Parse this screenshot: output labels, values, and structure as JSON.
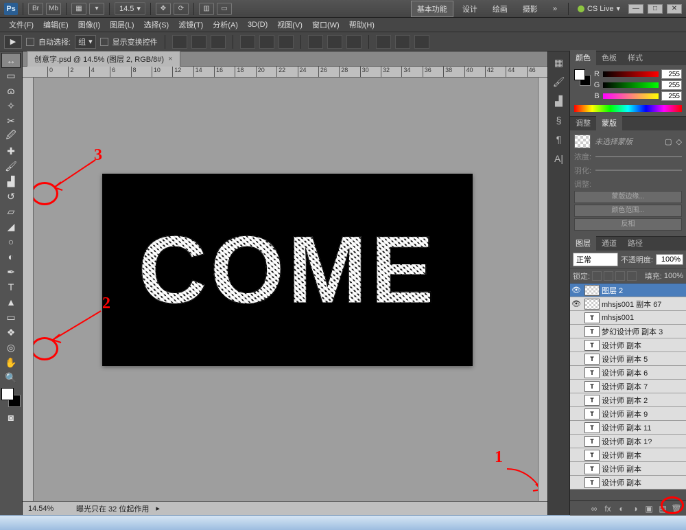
{
  "app": {
    "logo": "Ps"
  },
  "titlebar": {
    "zoom": "14.5",
    "workspaces": {
      "basic": "基本功能",
      "design": "设计",
      "draw": "绘画",
      "photo": "摄影"
    },
    "cslive": "CS Live"
  },
  "menu": {
    "file": "文件(F)",
    "edit": "编辑(E)",
    "image": "图像(I)",
    "layer": "图层(L)",
    "select": "选择(S)",
    "filter": "滤镜(T)",
    "analysis": "分析(A)",
    "threeD": "3D(D)",
    "view": "视图(V)",
    "window": "窗口(W)",
    "help": "帮助(H)"
  },
  "options": {
    "auto_select": "自动选择:",
    "group": "组",
    "show_controls": "显示变换控件"
  },
  "doc": {
    "tab_title": "创意字.psd @ 14.5% (图层 2, RGB/8#)",
    "canvas_text": "COME",
    "annotations": {
      "a1": "1",
      "a2": "2",
      "a3": "3"
    }
  },
  "status": {
    "zoom": "14.54%",
    "info": "曝光只在 32 位起作用"
  },
  "panels": {
    "color": {
      "tab_color": "颜色",
      "tab_swatches": "色板",
      "tab_styles": "样式",
      "r_label": "R",
      "g_label": "G",
      "b_label": "B",
      "r": "255",
      "g": "255",
      "b": "255"
    },
    "adjust": {
      "tab_adjust": "调整",
      "tab_masks": "蒙版",
      "no_mask": "未选择蒙版",
      "density": "浓度:",
      "feather": "羽化:",
      "refine": "调整:",
      "btn_edge": "蒙版边缘...",
      "btn_range": "颜色范围...",
      "btn_invert": "反相"
    },
    "layers": {
      "tab_layers": "图层",
      "tab_channels": "通道",
      "tab_paths": "路径",
      "blend": "正常",
      "opacity_label": "不透明度:",
      "opacity": "100%",
      "lock_label": "锁定:",
      "fill_label": "填充:",
      "fill": "100%",
      "items": [
        {
          "name": "图层 2",
          "type": "pix",
          "selected": true,
          "eye": true
        },
        {
          "name": "mhsjs001 副本 67",
          "type": "pix",
          "selected": false,
          "eye": true
        },
        {
          "name": "mhsjs001",
          "type": "T",
          "selected": false
        },
        {
          "name": "梦幻设计师 副本 3",
          "type": "T",
          "selected": false
        },
        {
          "name": "设计师 副本",
          "type": "T",
          "selected": false
        },
        {
          "name": "设计师 副本 5",
          "type": "T",
          "selected": false
        },
        {
          "name": "设计师 副本 6",
          "type": "T",
          "selected": false
        },
        {
          "name": "设计师 副本 7",
          "type": "T",
          "selected": false
        },
        {
          "name": "设计师 副本 2",
          "type": "T",
          "selected": false
        },
        {
          "name": "设计师 副本 9",
          "type": "T",
          "selected": false
        },
        {
          "name": "设计师 副本 11",
          "type": "T",
          "selected": false
        },
        {
          "name": "设计师 副本 1?",
          "type": "T",
          "selected": false
        },
        {
          "name": "设计师 副本",
          "type": "T",
          "selected": false
        },
        {
          "name": "设计师 副本",
          "type": "T",
          "selected": false
        },
        {
          "name": "设计师 副本",
          "type": "T",
          "selected": false
        }
      ]
    }
  }
}
